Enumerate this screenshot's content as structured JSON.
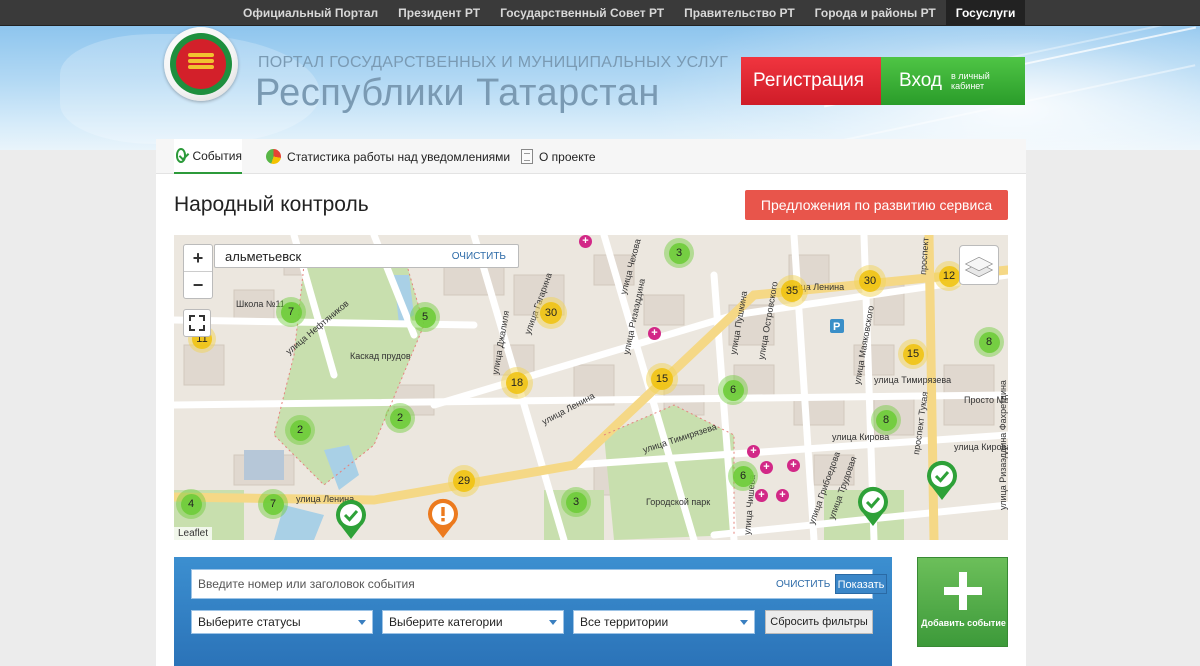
{
  "topnav": {
    "items": [
      "Официальный Портал",
      "Президент РТ",
      "Государственный Совет РТ",
      "Правительство РТ",
      "Города и районы РТ",
      "Госуслуги"
    ],
    "active_index": 5
  },
  "header": {
    "subtitle": "ПОРТАЛ ГОСУДАРСТВЕННЫХ И МУНИЦИПАЛЬНЫХ УСЛУГ",
    "title": "Республики Татарстан",
    "register_label": "Регистрация",
    "login_label": "Вход",
    "login_sub": "в личный кабинет"
  },
  "tabs": [
    {
      "label": "События",
      "icon": "check-circle-icon"
    },
    {
      "label": "Статистика работы над уведомлениями",
      "icon": "pie-chart-icon"
    },
    {
      "label": "О проекте",
      "icon": "document-icon"
    }
  ],
  "page": {
    "title": "Народный контроль",
    "suggest_button": "Предложения по развитию сервиса"
  },
  "map": {
    "search_value": "альметьевск",
    "search_clear": "ОЧИСТИТЬ",
    "zoom_in": "+",
    "zoom_out": "−",
    "attribution": "Leaflet",
    "clusters": [
      {
        "count": "3",
        "color": "green"
      },
      {
        "count": "7",
        "color": "green"
      },
      {
        "count": "11",
        "color": "yellow"
      },
      {
        "count": "5",
        "color": "green"
      },
      {
        "count": "30",
        "color": "yellow"
      },
      {
        "count": "18",
        "color": "yellow"
      },
      {
        "count": "15",
        "color": "yellow"
      },
      {
        "count": "35",
        "color": "yellow"
      },
      {
        "count": "30",
        "color": "yellow"
      },
      {
        "count": "12",
        "color": "yellow"
      },
      {
        "count": "8",
        "color": "green"
      },
      {
        "count": "15",
        "color": "yellow"
      },
      {
        "count": "6",
        "color": "green"
      },
      {
        "count": "8",
        "color": "green"
      },
      {
        "count": "2",
        "color": "green"
      },
      {
        "count": "2",
        "color": "green"
      },
      {
        "count": "29",
        "color": "yellow"
      },
      {
        "count": "6",
        "color": "green"
      },
      {
        "count": "7",
        "color": "green"
      },
      {
        "count": "4",
        "color": "green"
      },
      {
        "count": "3",
        "color": "green"
      }
    ],
    "street_labels": [
      "улица Нефтяников",
      "Каскад прудов",
      "улица Ленина",
      "улица Ленина",
      "улица Ленина",
      "улица Тимирязева",
      "улица Тимирязева",
      "улица Кирова",
      "улица Кирова",
      "Городской парк",
      "Школа №11",
      "Просто Молоко",
      "улица Джалиля",
      "проспект Тукая",
      "проспект Тукая",
      "улица Маяковского",
      "улица Трудовая",
      "улица Ризаэддина Фахретдина",
      "улица Чишева",
      "улица Островского",
      "улица Ризаэддина",
      "улица Гагарина",
      "улица Грибоедова",
      "улица Чехова",
      "улица Пушкина"
    ]
  },
  "filter": {
    "search_placeholder": "Введите номер или заголовок события",
    "clear_label": "ОЧИСТИТЬ",
    "show_label": "Показать",
    "status_select": "Выберите статусы",
    "category_select": "Выберите категории",
    "territory_select": "Все территории",
    "reset_label": "Сбросить фильтры"
  },
  "add_event": {
    "label": "Добавить событие"
  },
  "colors": {
    "topnav_bg": "#3a3a3a",
    "register": "#d72530",
    "login": "#3aa935",
    "suggest": "#e8554b",
    "filter_bg": "#2f7dc2",
    "add_event": "#4fa845",
    "cluster_green": "#6ecc39",
    "cluster_yellow": "#f0c20c",
    "pin_ok": "#2ea138",
    "pin_warn": "#ec7a1e",
    "hospital": "#d22887"
  }
}
